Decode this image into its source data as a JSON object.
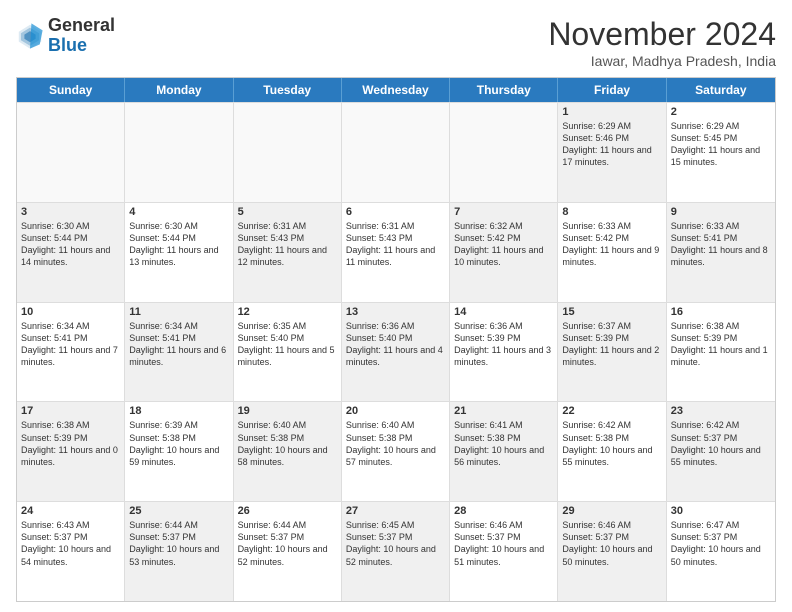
{
  "logo": {
    "general": "General",
    "blue": "Blue"
  },
  "header": {
    "month": "November 2024",
    "location": "Iawar, Madhya Pradesh, India"
  },
  "weekdays": [
    "Sunday",
    "Monday",
    "Tuesday",
    "Wednesday",
    "Thursday",
    "Friday",
    "Saturday"
  ],
  "rows": [
    [
      {
        "day": "",
        "data": "",
        "empty": true
      },
      {
        "day": "",
        "data": "",
        "empty": true
      },
      {
        "day": "",
        "data": "",
        "empty": true
      },
      {
        "day": "",
        "data": "",
        "empty": true
      },
      {
        "day": "",
        "data": "",
        "empty": true
      },
      {
        "day": "1",
        "data": "Sunrise: 6:29 AM\nSunset: 5:46 PM\nDaylight: 11 hours and 17 minutes.",
        "shaded": true
      },
      {
        "day": "2",
        "data": "Sunrise: 6:29 AM\nSunset: 5:45 PM\nDaylight: 11 hours and 15 minutes.",
        "shaded": false
      }
    ],
    [
      {
        "day": "3",
        "data": "Sunrise: 6:30 AM\nSunset: 5:44 PM\nDaylight: 11 hours and 14 minutes.",
        "shaded": true
      },
      {
        "day": "4",
        "data": "Sunrise: 6:30 AM\nSunset: 5:44 PM\nDaylight: 11 hours and 13 minutes.",
        "shaded": false
      },
      {
        "day": "5",
        "data": "Sunrise: 6:31 AM\nSunset: 5:43 PM\nDaylight: 11 hours and 12 minutes.",
        "shaded": true
      },
      {
        "day": "6",
        "data": "Sunrise: 6:31 AM\nSunset: 5:43 PM\nDaylight: 11 hours and 11 minutes.",
        "shaded": false
      },
      {
        "day": "7",
        "data": "Sunrise: 6:32 AM\nSunset: 5:42 PM\nDaylight: 11 hours and 10 minutes.",
        "shaded": true
      },
      {
        "day": "8",
        "data": "Sunrise: 6:33 AM\nSunset: 5:42 PM\nDaylight: 11 hours and 9 minutes.",
        "shaded": false
      },
      {
        "day": "9",
        "data": "Sunrise: 6:33 AM\nSunset: 5:41 PM\nDaylight: 11 hours and 8 minutes.",
        "shaded": true
      }
    ],
    [
      {
        "day": "10",
        "data": "Sunrise: 6:34 AM\nSunset: 5:41 PM\nDaylight: 11 hours and 7 minutes.",
        "shaded": false
      },
      {
        "day": "11",
        "data": "Sunrise: 6:34 AM\nSunset: 5:41 PM\nDaylight: 11 hours and 6 minutes.",
        "shaded": true
      },
      {
        "day": "12",
        "data": "Sunrise: 6:35 AM\nSunset: 5:40 PM\nDaylight: 11 hours and 5 minutes.",
        "shaded": false
      },
      {
        "day": "13",
        "data": "Sunrise: 6:36 AM\nSunset: 5:40 PM\nDaylight: 11 hours and 4 minutes.",
        "shaded": true
      },
      {
        "day": "14",
        "data": "Sunrise: 6:36 AM\nSunset: 5:39 PM\nDaylight: 11 hours and 3 minutes.",
        "shaded": false
      },
      {
        "day": "15",
        "data": "Sunrise: 6:37 AM\nSunset: 5:39 PM\nDaylight: 11 hours and 2 minutes.",
        "shaded": true
      },
      {
        "day": "16",
        "data": "Sunrise: 6:38 AM\nSunset: 5:39 PM\nDaylight: 11 hours and 1 minute.",
        "shaded": false
      }
    ],
    [
      {
        "day": "17",
        "data": "Sunrise: 6:38 AM\nSunset: 5:39 PM\nDaylight: 11 hours and 0 minutes.",
        "shaded": true
      },
      {
        "day": "18",
        "data": "Sunrise: 6:39 AM\nSunset: 5:38 PM\nDaylight: 10 hours and 59 minutes.",
        "shaded": false
      },
      {
        "day": "19",
        "data": "Sunrise: 6:40 AM\nSunset: 5:38 PM\nDaylight: 10 hours and 58 minutes.",
        "shaded": true
      },
      {
        "day": "20",
        "data": "Sunrise: 6:40 AM\nSunset: 5:38 PM\nDaylight: 10 hours and 57 minutes.",
        "shaded": false
      },
      {
        "day": "21",
        "data": "Sunrise: 6:41 AM\nSunset: 5:38 PM\nDaylight: 10 hours and 56 minutes.",
        "shaded": true
      },
      {
        "day": "22",
        "data": "Sunrise: 6:42 AM\nSunset: 5:38 PM\nDaylight: 10 hours and 55 minutes.",
        "shaded": false
      },
      {
        "day": "23",
        "data": "Sunrise: 6:42 AM\nSunset: 5:37 PM\nDaylight: 10 hours and 55 minutes.",
        "shaded": true
      }
    ],
    [
      {
        "day": "24",
        "data": "Sunrise: 6:43 AM\nSunset: 5:37 PM\nDaylight: 10 hours and 54 minutes.",
        "shaded": false
      },
      {
        "day": "25",
        "data": "Sunrise: 6:44 AM\nSunset: 5:37 PM\nDaylight: 10 hours and 53 minutes.",
        "shaded": true
      },
      {
        "day": "26",
        "data": "Sunrise: 6:44 AM\nSunset: 5:37 PM\nDaylight: 10 hours and 52 minutes.",
        "shaded": false
      },
      {
        "day": "27",
        "data": "Sunrise: 6:45 AM\nSunset: 5:37 PM\nDaylight: 10 hours and 52 minutes.",
        "shaded": true
      },
      {
        "day": "28",
        "data": "Sunrise: 6:46 AM\nSunset: 5:37 PM\nDaylight: 10 hours and 51 minutes.",
        "shaded": false
      },
      {
        "day": "29",
        "data": "Sunrise: 6:46 AM\nSunset: 5:37 PM\nDaylight: 10 hours and 50 minutes.",
        "shaded": true
      },
      {
        "day": "30",
        "data": "Sunrise: 6:47 AM\nSunset: 5:37 PM\nDaylight: 10 hours and 50 minutes.",
        "shaded": false
      }
    ]
  ]
}
